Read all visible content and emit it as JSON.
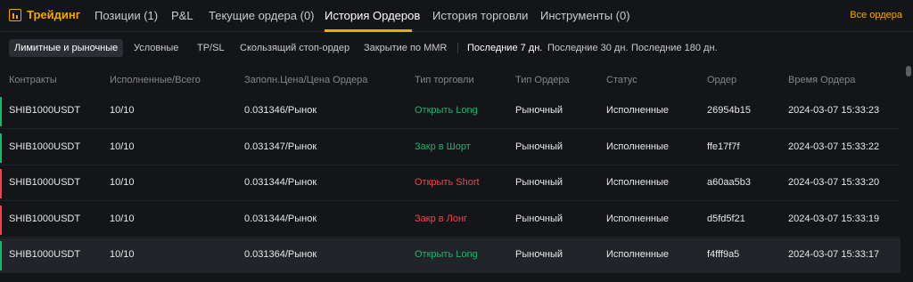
{
  "brand": {
    "label": "Трейдинг",
    "icon": "chart-icon",
    "color": "#f7a600"
  },
  "tabs": [
    {
      "label": "Позиции (1)",
      "active": false
    },
    {
      "label": "P&L",
      "active": false
    },
    {
      "label": "Текущие ордера (0)",
      "active": false
    },
    {
      "label": "История Ордеров",
      "active": true
    },
    {
      "label": "История торговли",
      "active": false
    },
    {
      "label": "Инструменты (0)",
      "active": false
    }
  ],
  "all_orders_link": "Все ордера",
  "filters": {
    "order_types": [
      {
        "label": "Лимитные и рыночные",
        "active": true
      },
      {
        "label": "Условные",
        "active": false
      },
      {
        "label": "TP/SL",
        "active": false
      },
      {
        "label": "Скользящий стоп-ордер",
        "active": false
      },
      {
        "label": "Закрытие по MMR",
        "active": false
      }
    ],
    "periods": [
      {
        "label": "Последние 7 дн.",
        "active": true
      },
      {
        "label": "Последние 30 дн.",
        "active": false
      },
      {
        "label": "Последние 180 дн.",
        "active": false
      }
    ]
  },
  "columns": [
    "Контракты",
    "Исполненные/Всего",
    "Заполн.Цена/Цена Ордера",
    "Тип торговли",
    "Тип Ордера",
    "Статус",
    "Ордер",
    "Время Ордера"
  ],
  "colors": {
    "long": "#20b26c",
    "short": "#ef454a"
  },
  "rows": [
    {
      "contract": "SHIB1000USDT",
      "filled": "10/10",
      "price": "0.031346/Рынок",
      "trade_type": "Открыть Long",
      "side": "long",
      "order_type": "Рыночный",
      "status": "Исполненные",
      "order_id": "26954b15",
      "time": "2024-03-07 15:33:23"
    },
    {
      "contract": "SHIB1000USDT",
      "filled": "10/10",
      "price": "0.031347/Рынок",
      "trade_type": "Закр в Шорт",
      "side": "long",
      "order_type": "Рыночный",
      "status": "Исполненные",
      "order_id": "ffe17f7f",
      "time": "2024-03-07 15:33:22"
    },
    {
      "contract": "SHIB1000USDT",
      "filled": "10/10",
      "price": "0.031344/Рынок",
      "trade_type": "Открыть Short",
      "side": "short",
      "order_type": "Рыночный",
      "status": "Исполненные",
      "order_id": "a60aa5b3",
      "time": "2024-03-07 15:33:20"
    },
    {
      "contract": "SHIB1000USDT",
      "filled": "10/10",
      "price": "0.031344/Рынок",
      "trade_type": "Закр в Лонг",
      "side": "short",
      "order_type": "Рыночный",
      "status": "Исполненные",
      "order_id": "d5fd5f21",
      "time": "2024-03-07 15:33:19"
    },
    {
      "contract": "SHIB1000USDT",
      "filled": "10/10",
      "price": "0.031364/Рынок",
      "trade_type": "Открыть Long",
      "side": "long",
      "order_type": "Рыночный",
      "status": "Исполненные",
      "order_id": "f4fff9a5",
      "time": "2024-03-07 15:33:17",
      "highlighted": true
    }
  ]
}
